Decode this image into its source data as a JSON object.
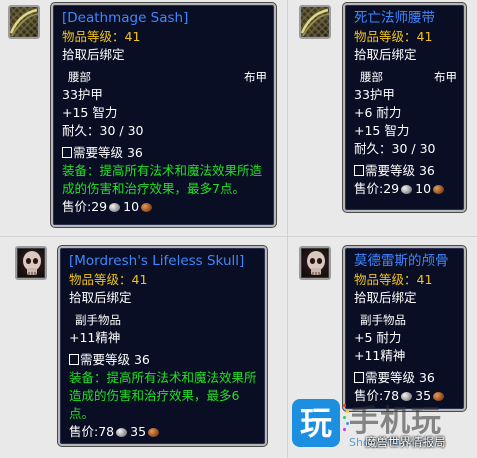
{
  "items": [
    {
      "id": "sash-en",
      "name": "[Deathmage Sash]",
      "item_level": "物品等级：41",
      "bind": "拾取后绑定",
      "slot": "腰部",
      "type": "布甲",
      "stats": [
        "33护甲",
        "+15 智力",
        "耐久：30 / 30"
      ],
      "requirement": "需要等级 36",
      "equip": "装备：提高所有法术和魔法效果所造成的伤害和治疗效果，最多7点。",
      "price_label": "售价:",
      "silver": "29",
      "copper": "10"
    },
    {
      "id": "sash-cn",
      "name": "死亡法师腰带",
      "item_level": "物品等级：41",
      "bind": "拾取后绑定",
      "slot": "腰部",
      "type": "布甲",
      "stats": [
        "33护甲",
        "+6 耐力",
        "+15 智力",
        "耐久：30 / 30"
      ],
      "requirement": "需要等级 36",
      "price_label": "售价:",
      "silver": "29",
      "copper": "10"
    },
    {
      "id": "skull-en",
      "name": "[Mordresh's Lifeless Skull]",
      "item_level": "物品等级：41",
      "bind": "拾取后绑定",
      "slot": "副手物品",
      "stats": [
        "+11精神"
      ],
      "requirement": "需要等级 36",
      "equip": "装备：提高所有法术和魔法效果所造成的伤害和治疗效果，最多6点。",
      "price_label": "售价:",
      "silver": "78",
      "copper": "35"
    },
    {
      "id": "skull-cn",
      "name": "莫德雷斯的颅骨",
      "item_level": "物品等级：41",
      "bind": "拾取后绑定",
      "slot": "副手物品",
      "stats": [
        "+5 耐力",
        "+11精神"
      ],
      "requirement": "需要等级 36",
      "price_label": "售价:",
      "silver": "78",
      "copper": "35"
    }
  ],
  "icons": {
    "sash": "cloth-sash-item-icon",
    "skull": "lifeless-skull-item-icon"
  },
  "colors": {
    "tooltip_bg": "#0a0e24",
    "item_name": "#3f87ff",
    "item_level": "#f0c419",
    "equip_text": "#21e021",
    "border": "#b7b7b7"
  },
  "watermark": {
    "logo_char": "玩",
    "brand": "手机玩",
    "url": "ShouJiWan.com",
    "subtitle": "魔兽世界情报局"
  }
}
